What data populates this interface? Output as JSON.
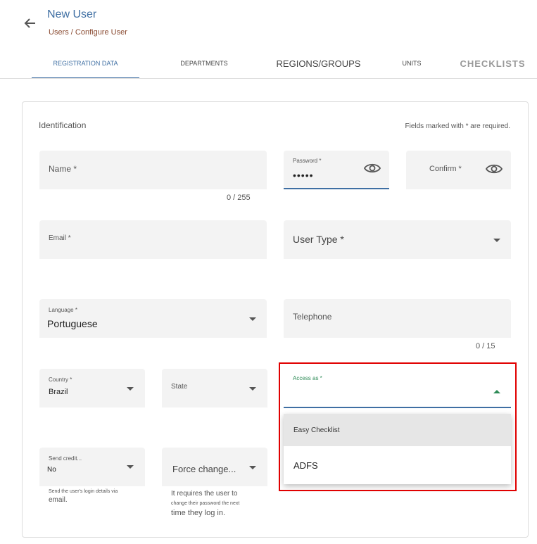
{
  "header": {
    "title": "New User",
    "breadcrumb": "Users / Configure User"
  },
  "tabs": [
    {
      "label": "REGISTRATION DATA"
    },
    {
      "label": "DEPARTMENTS"
    },
    {
      "label": "REGIONS/GROUPS"
    },
    {
      "label": "UNITS"
    },
    {
      "label": "CHECKLISTS"
    }
  ],
  "form": {
    "section_title": "Identification",
    "required_note": "Fields marked with * are required.",
    "name": {
      "label": "Name *",
      "counter": "0 / 255"
    },
    "password": {
      "label": "Password *",
      "value": "•••••"
    },
    "confirm": {
      "label": "Confirm *"
    },
    "email": {
      "label": "Email *"
    },
    "user_type": {
      "label": "User Type *"
    },
    "language": {
      "label": "Language *",
      "value": "Portuguese"
    },
    "telephone": {
      "label": "Telephone",
      "counter": "0 / 15"
    },
    "country": {
      "label": "Country *",
      "value": "Brazil"
    },
    "state": {
      "label": "State"
    },
    "access_as": {
      "label": "Access as *"
    },
    "send_credit": {
      "label": "Send credit...",
      "value": "No",
      "hint_small": "Send the user's login details via",
      "hint_big": "email."
    },
    "force_change": {
      "label": "Force change...",
      "hint_big1": "It requires the user to",
      "hint_small": "change their password the next",
      "hint_big2": "time they log in."
    }
  },
  "dropdown": {
    "options": [
      "Easy Checklist",
      "ADFS"
    ]
  },
  "colors": {
    "accent": "#3f6fa3",
    "highlight": "#e00000",
    "access_green": "#2e8b57"
  }
}
